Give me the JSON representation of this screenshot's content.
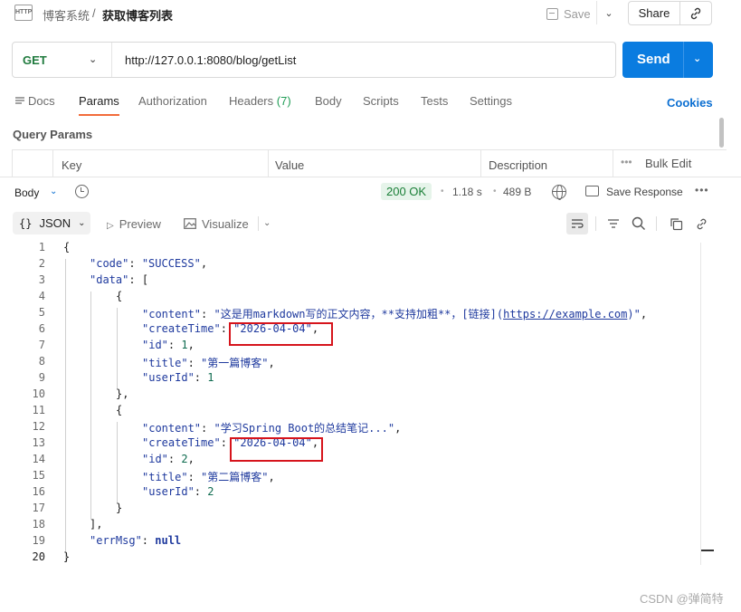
{
  "header": {
    "http_icon_label": "HTTP",
    "breadcrumb_parent": "博客系统",
    "breadcrumb_sep": "/",
    "title": "获取博客列表",
    "save_label": "Save",
    "share_label": "Share"
  },
  "request": {
    "method": "GET",
    "url": "http://127.0.0.1:8080/blog/getList",
    "send_label": "Send"
  },
  "request_tabs": {
    "docs": "Docs",
    "params": "Params",
    "authorization": "Authorization",
    "headers": "Headers",
    "headers_count": "(7)",
    "body": "Body",
    "scripts": "Scripts",
    "tests": "Tests",
    "settings": "Settings",
    "cookies": "Cookies"
  },
  "query_params": {
    "title": "Query Params",
    "col_key": "Key",
    "col_value": "Value",
    "col_description": "Description",
    "bulk_edit": "Bulk Edit"
  },
  "response": {
    "body_label": "Body",
    "status": "200 OK",
    "time": "1.18 s",
    "size": "489 B",
    "save_response": "Save Response",
    "format": "JSON",
    "preview": "Preview",
    "visualize": "Visualize"
  },
  "code": {
    "line_numbers": [
      "1",
      "2",
      "3",
      "4",
      "5",
      "6",
      "7",
      "8",
      "9",
      "10",
      "11",
      "12",
      "13",
      "14",
      "15",
      "16",
      "17",
      "18",
      "19",
      "20"
    ],
    "brace_open": "{",
    "brace_close": "}",
    "k_code": "\"code\"",
    "v_code": "\"SUCCESS\"",
    "k_data": "\"data\"",
    "bracket_open": "[",
    "bracket_close": "],",
    "obj_open": "{",
    "obj_close_comma": "},",
    "obj_close": "}",
    "k_content": "\"content\"",
    "v_content1_a": "\"这是用markdown写的正文内容，**支持加粗**，[链接](",
    "v_content1_link": "https://example.com",
    "v_content1_b": ")\"",
    "k_createTime": "\"createTime\"",
    "v_createTime1": "\"2026-04-04\"",
    "k_id": "\"id\"",
    "v_id1": "1",
    "k_title": "\"title\"",
    "v_title1": "\"第一篇博客\"",
    "k_userId": "\"userId\"",
    "v_userId1": "1",
    "v_content2": "\"学习Spring Boot的总结笔记...\"",
    "v_createTime2": "\"2026-04-04\"",
    "v_id2": "2",
    "v_title2": "\"第二篇博客\"",
    "v_userId2": "2",
    "k_errMsg": "\"errMsg\"",
    "v_errMsg": "null"
  },
  "watermark": "CSDN @弹简特",
  "colors": {
    "send_button": "#0a7ce0",
    "active_tab_underline": "#f26b3a",
    "status_ok": "#1a7f37",
    "highlight_box": "#d6141c"
  }
}
